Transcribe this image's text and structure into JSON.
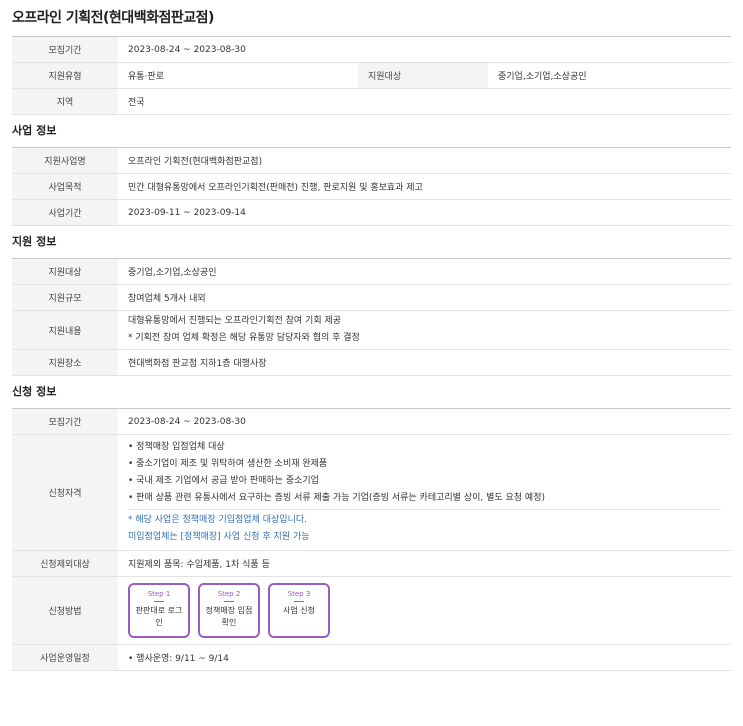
{
  "page_title": "오프라인 기획전(현대백화점판교점)",
  "summary": {
    "period_label": "모집기간",
    "period_value": "2023-08-24 ~ 2023-08-30",
    "type_label": "지원유형",
    "type_value": "유통·판로",
    "target_label": "지원대상",
    "target_value": "중기업,소기업,소상공인",
    "region_label": "지역",
    "region_value": "전국"
  },
  "business": {
    "title": "사업 정보",
    "rows": [
      {
        "label": "지원사업명",
        "value": "오프라인 기획전(현대백화점판교점)"
      },
      {
        "label": "사업목적",
        "value": "민간 대형유통망에서 오프라인기획전(판매전) 진행, 판로지원 및 홍보효과 제고"
      },
      {
        "label": "사업기간",
        "value": "2023-09-11 ~ 2023-09-14"
      }
    ]
  },
  "support": {
    "title": "지원 정보",
    "target_label": "지원대상",
    "target_value": "중기업,소기업,소상공인",
    "scale_label": "지원규모",
    "scale_value": "참여업체 5개사 내외",
    "content_label": "지원내용",
    "content_line1": "대형유통망에서 진행되는 오프라인기획전 참여 기회 제공",
    "content_line2": "* 기획전 참여 업체 확정은 해당 유통망 담당자와 협의 후 결정",
    "place_label": "지원장소",
    "place_value": "현대백화점 판교점 지하1층 대행사장"
  },
  "apply": {
    "title": "신청 정보",
    "period_label": "모집기간",
    "period_value": "2023-08-24 ~ 2023-08-30",
    "qual_label": "신청자격",
    "qual_items": [
      "• 정책매장 입점업체 대상",
      "• 중소기업이 제조 및 위탁하여 생산한 소비재 완제품",
      "• 국내 제조 기업에서 공급 받아 판매하는 중소기업",
      "• 판매 상품 관련 유통사에서 요구하는 증빙 서류 제출 가능 기업(증빙 서류는 카테고리별 상이, 별도 요청 예정)"
    ],
    "qual_note1": "* 해당 사업은 정책매장 기입점업체 대상입니다.",
    "qual_note2": "미입점업체는 [정책매장] 사업 신청 후 지원 가능",
    "exclude_label": "신청제외대상",
    "exclude_value": "지원제외 품목: 수입제품, 1차 식품 등",
    "method_label": "신청방법",
    "steps": [
      {
        "no": "Step 1",
        "text": "판판대로 로그인"
      },
      {
        "no": "Step 2",
        "text": "정책매장 입점확인"
      },
      {
        "no": "Step 3",
        "text": "사업 신청"
      }
    ],
    "schedule_label": "사업운영일정",
    "schedule_value": "• 행사운영: 9/11 ~ 9/14"
  }
}
